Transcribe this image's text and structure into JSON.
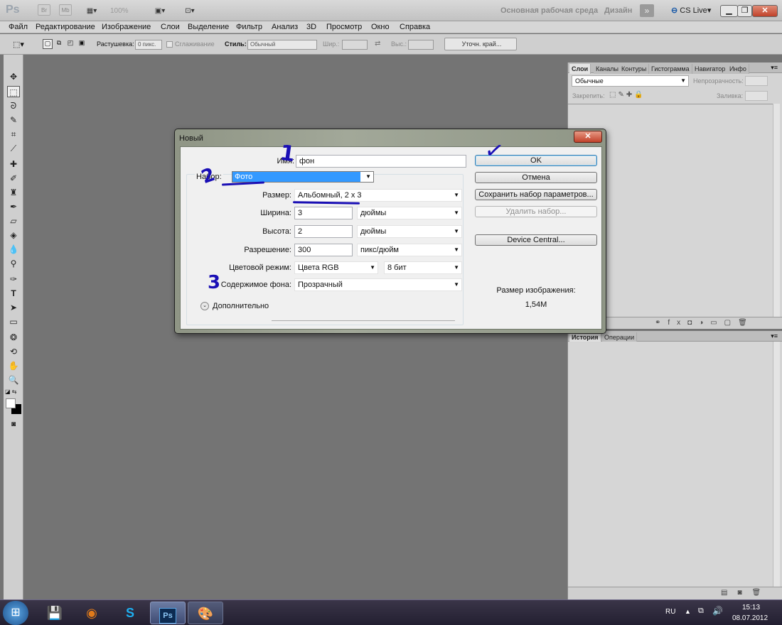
{
  "app": {
    "logo": "Ps",
    "bridge": "Br",
    "minibridge": "Mb",
    "zoom": "100%",
    "workspace": "Основная рабочая среда",
    "design": "Дизайн",
    "cslive": "CS Live"
  },
  "menu": [
    "Файл",
    "Редактирование",
    "Изображение",
    "Слои",
    "Выделение",
    "Фильтр",
    "Анализ",
    "3D",
    "Просмотр",
    "Окно",
    "Справка"
  ],
  "options": {
    "feather_label": "Растушевка:",
    "feather_value": "0 пикс.",
    "antialias": "Сглаживание",
    "style_label": "Стиль:",
    "style_value": "Обычный",
    "width_label": "Шир.:",
    "height_label": "Выс.:",
    "refine": "Уточн. край..."
  },
  "layers_panel": {
    "tabs": [
      "Слои",
      "Каналы",
      "Контуры",
      "Гистограмма",
      "Навигатор",
      "Инфо"
    ],
    "blend": "Обычные",
    "opacity_label": "Непрозрачность:",
    "lock_label": "Закрепить:",
    "fill_label": "Заливка:"
  },
  "history_panel": {
    "tabs": [
      "История",
      "Операции"
    ]
  },
  "dialog": {
    "title": "Новый",
    "name_label": "Имя:",
    "name_value": "фон",
    "preset_label": "Набор:",
    "preset_value": "Фото",
    "size_label": "Размер:",
    "size_value": "Альбомный, 2 x 3",
    "width_label": "Ширина:",
    "width_value": "3",
    "width_unit": "дюймы",
    "height_label": "Высота:",
    "height_value": "2",
    "height_unit": "дюймы",
    "res_label": "Разрешение:",
    "res_value": "300",
    "res_unit": "пикс/дюйм",
    "mode_label": "Цветовой режим:",
    "mode_value": "Цвета RGB",
    "bits_value": "8 бит",
    "bg_label": "Содержимое фона:",
    "bg_value": "Прозрачный",
    "advanced": "Дополнительно",
    "ok": "OK",
    "cancel": "Отмена",
    "save_preset": "Сохранить набор параметров...",
    "delete_preset": "Удалить набор...",
    "device_central": "Device Central...",
    "image_size_label": "Размер изображения:",
    "image_size_value": "1,54M"
  },
  "annotations": [
    "1",
    "2",
    "3",
    "✓"
  ],
  "taskbar": {
    "lang": "RU",
    "time": "15:13",
    "date": "08.07.2012"
  }
}
